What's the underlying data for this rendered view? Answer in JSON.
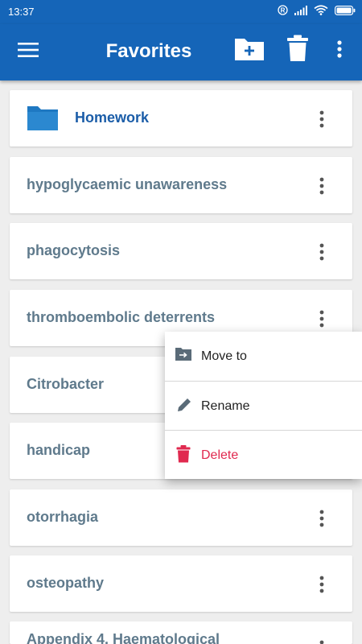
{
  "status": {
    "time": "13:37",
    "icons": [
      "registered-icon",
      "signal-icon",
      "wifi-icon",
      "battery-icon"
    ]
  },
  "header": {
    "title": "Favorites",
    "actions": [
      "menu-icon",
      "new-folder-icon",
      "trash-icon",
      "more-vert-icon"
    ]
  },
  "list": {
    "folder": {
      "label": "Homework",
      "icon": "folder-icon"
    },
    "items": [
      {
        "label": "hypoglycaemic unawareness"
      },
      {
        "label": "phagocytosis"
      },
      {
        "label": "thromboembolic deterrents"
      },
      {
        "label": "Citrobacter"
      },
      {
        "label": "handicap"
      },
      {
        "label": "otorrhagia"
      },
      {
        "label": "osteopathy"
      },
      {
        "label": "Appendix 4. Haematological"
      }
    ]
  },
  "context_menu": {
    "items": [
      {
        "label": "Move to",
        "icon": "move-to-icon"
      },
      {
        "label": "Rename",
        "icon": "pencil-icon"
      },
      {
        "label": "Delete",
        "icon": "delete-icon",
        "color": "#e0294f"
      }
    ]
  },
  "colors": {
    "primary": "#1565b8",
    "folder_text": "#1b5da8",
    "item_text": "#5f7a8c",
    "background": "#eeeeee",
    "danger": "#e0294f"
  }
}
